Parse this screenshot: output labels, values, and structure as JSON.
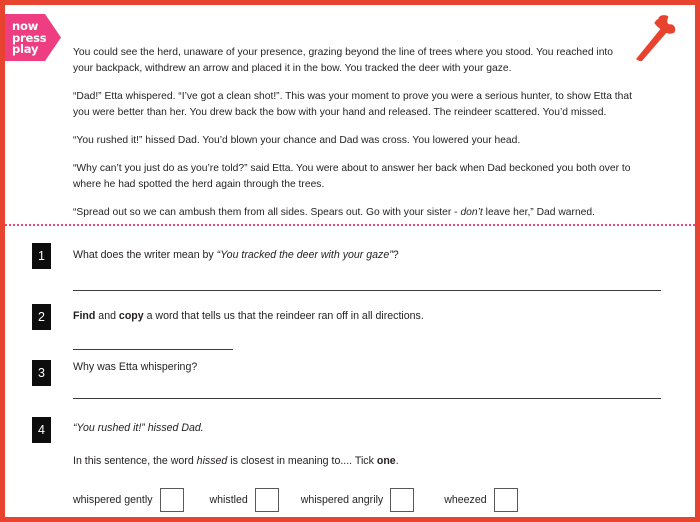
{
  "brand": {
    "logo_lines": [
      "now",
      "press",
      "play"
    ],
    "logo_color": "#ee3e81",
    "border_color": "#e8432f",
    "divider_color": "#f0457f",
    "icon": "stone-axe-icon"
  },
  "passage": {
    "paragraphs": [
      {
        "id": "p1",
        "runs": [
          {
            "text": "You could see the herd, unaware of your presence, grazing beyond the line of trees where you stood. You reached into your backpack, withdrew an arrow and placed it in the bow. You tracked the deer with your gaze.",
            "style": "normal"
          }
        ]
      },
      {
        "id": "p2",
        "runs": [
          {
            "text": "“Dad!” Etta whispered. “I’ve got a clean shot!”. This was your moment to prove you were a serious hunter, to show Etta that you were better than her. You drew back the bow with your hand and released. The reindeer scattered. You’d missed.",
            "style": "normal"
          }
        ]
      },
      {
        "id": "p3",
        "runs": [
          {
            "text": "“You rushed it!” hissed Dad.  You’d blown your chance and Dad was cross. You lowered your head.",
            "style": "normal"
          }
        ]
      },
      {
        "id": "p4",
        "runs": [
          {
            "text": "“Why can’t you just do as you’re told?” said Etta. You were about to answer her back when Dad beckoned you both over to where he had spotted the herd again through the trees.",
            "style": "normal"
          }
        ]
      },
      {
        "id": "p5",
        "runs": [
          {
            "text": "“Spread out so we can ambush them from all sides. Spears out. Go with your sister - ",
            "style": "normal"
          },
          {
            "text": "don’t",
            "style": "italic"
          },
          {
            "text": " leave her,” Dad warned.",
            "style": "normal"
          }
        ]
      }
    ]
  },
  "questions": [
    {
      "number": "1",
      "runs": [
        {
          "text": "What does the writer mean by ",
          "style": "normal"
        },
        {
          "text": "“You tracked the deer with your gaze”",
          "style": "italic"
        },
        {
          "text": "?",
          "style": "normal"
        }
      ],
      "answer_line": "full"
    },
    {
      "number": "2",
      "runs": [
        {
          "text": "Find",
          "style": "bold"
        },
        {
          "text": " and ",
          "style": "normal"
        },
        {
          "text": "copy",
          "style": "bold"
        },
        {
          "text": " a word that tells us that the reindeer ran off in all directions.",
          "style": "normal"
        }
      ],
      "answer_line": "short"
    },
    {
      "number": "3",
      "runs": [
        {
          "text": "Why was Etta whispering?",
          "style": "normal"
        }
      ],
      "answer_line": "full"
    },
    {
      "number": "4",
      "runs": [
        {
          "text": "“You rushed it!” hissed Dad.",
          "style": "italic"
        }
      ],
      "answer_line": "none"
    }
  ],
  "question4_followup": {
    "runs": [
      {
        "text": "In this sentence, the word ",
        "style": "normal"
      },
      {
        "text": "hissed",
        "style": "italic"
      },
      {
        "text": " is closest in meaning to.... Tick ",
        "style": "normal"
      },
      {
        "text": "one",
        "style": "bold"
      },
      {
        "text": ".",
        "style": "normal"
      }
    ]
  },
  "options": [
    {
      "label": "whispered gently",
      "checked": false
    },
    {
      "label": "whistled",
      "checked": false
    },
    {
      "label": "whispered angrily",
      "checked": false
    },
    {
      "label": "wheezed",
      "checked": false
    }
  ]
}
